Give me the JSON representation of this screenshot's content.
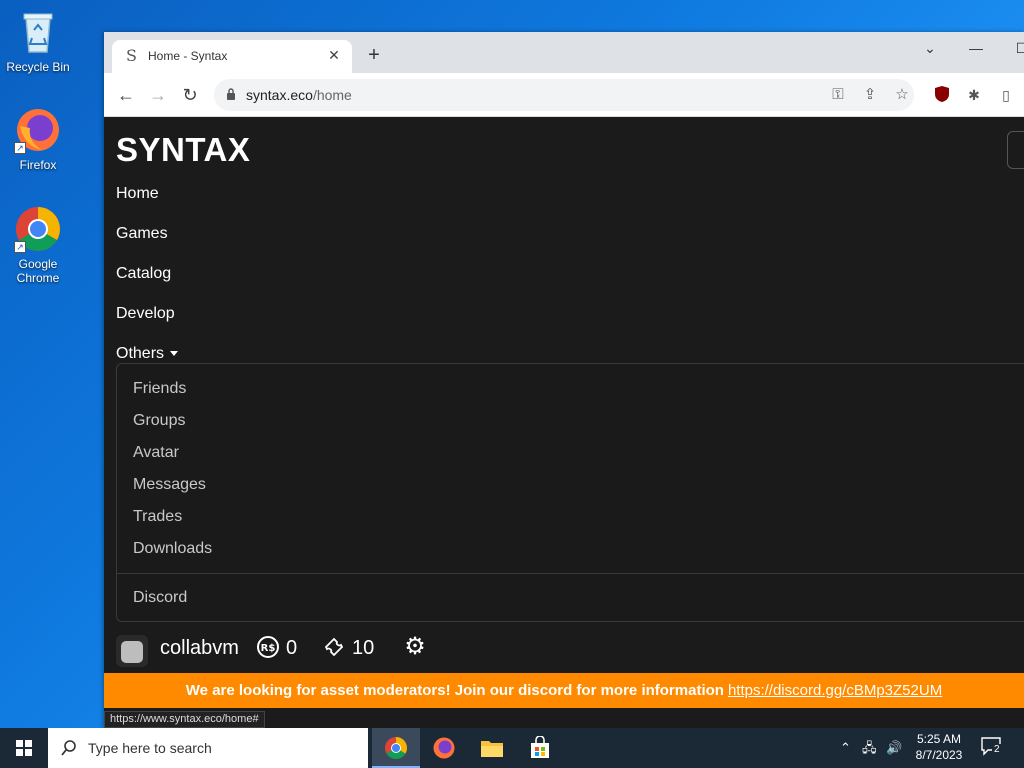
{
  "desktop": {
    "icons": [
      {
        "label": "Recycle Bin"
      },
      {
        "label": "Firefox"
      },
      {
        "label": "Google Chrome"
      }
    ]
  },
  "browser": {
    "tab_title": "Home - Syntax",
    "url_host": "syntax.eco",
    "url_path": "/home",
    "status_url": "https://www.syntax.eco/home#"
  },
  "site": {
    "brand": "SYNTAX",
    "nav": [
      "Home",
      "Games",
      "Catalog",
      "Develop",
      "Others"
    ],
    "dropdown": [
      "Friends",
      "Groups",
      "Avatar",
      "Messages",
      "Trades",
      "Downloads"
    ],
    "dropdown_extra": "Discord",
    "user": {
      "name": "collabvm",
      "robux": "0",
      "tickets": "10"
    },
    "banner_text": "We are looking for asset moderators! Join our discord for more information",
    "banner_link": "https://discord.gg/cBMp3Z52UM"
  },
  "taskbar": {
    "search_placeholder": "Type here to search",
    "time": "5:25 AM",
    "date": "8/7/2023",
    "notifications": "2"
  }
}
